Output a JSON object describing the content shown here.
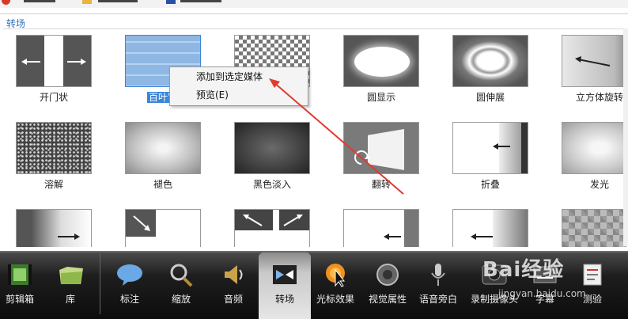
{
  "section_title": "转场",
  "transitions": [
    {
      "label": "开门状",
      "selected": false
    },
    {
      "label": "百叶窗",
      "selected": true
    },
    {
      "label": "",
      "selected": false
    },
    {
      "label": "圆显示",
      "selected": false
    },
    {
      "label": "圆伸展",
      "selected": false
    },
    {
      "label": "立方体旋转",
      "selected": false
    },
    {
      "label": "溶解",
      "selected": false
    },
    {
      "label": "褪色",
      "selected": false
    },
    {
      "label": "黑色淡入",
      "selected": false
    },
    {
      "label": "翻转",
      "selected": false
    },
    {
      "label": "折叠",
      "selected": false
    },
    {
      "label": "发光",
      "selected": false
    }
  ],
  "context_menu": {
    "items": [
      "添加到选定媒体",
      "预览(E)"
    ]
  },
  "toolbar": {
    "items": [
      {
        "label": "剪辑箱",
        "icon": "film-icon"
      },
      {
        "label": "库",
        "icon": "library-folder-icon"
      },
      {
        "label": "标注",
        "icon": "callout-bubble-icon"
      },
      {
        "label": "缩放",
        "icon": "zoom-magnifier-icon"
      },
      {
        "label": "音频",
        "icon": "speaker-icon"
      },
      {
        "label": "转场",
        "icon": "transition-icon",
        "active": true
      },
      {
        "label": "光标效果",
        "icon": "cursor-effect-icon"
      },
      {
        "label": "视觉属性",
        "icon": "visual-properties-icon"
      },
      {
        "label": "语音旁白",
        "icon": "microphone-icon"
      },
      {
        "label": "录制摄像头",
        "icon": "webcam-icon"
      },
      {
        "label": "字幕",
        "icon": "captions-icon"
      },
      {
        "label": "测验",
        "icon": "quiz-icon"
      }
    ]
  },
  "watermark": {
    "text": "Bai经验",
    "sub": "jingyan.baidu.com"
  },
  "annotation_color": "#e03a2f"
}
